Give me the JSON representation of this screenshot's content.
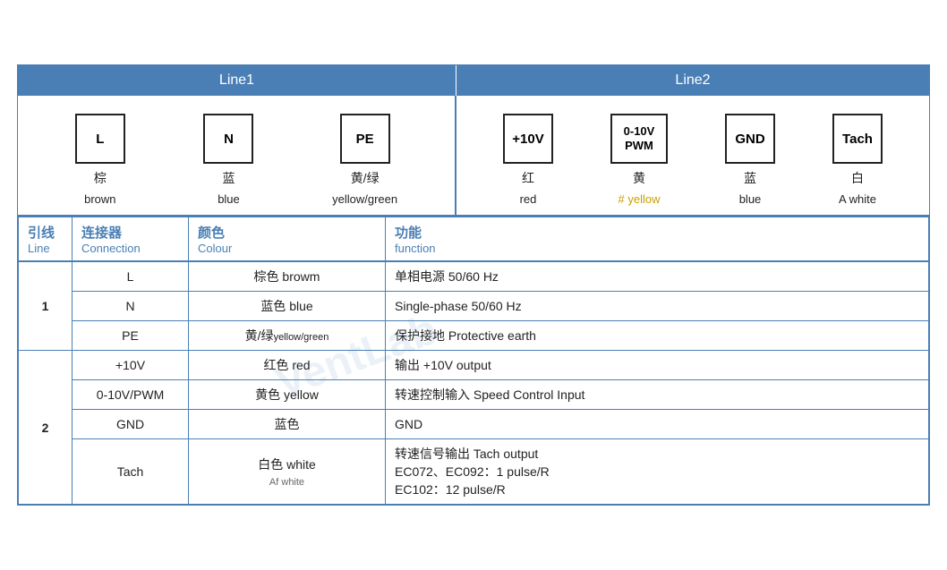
{
  "header": {
    "line1_label": "Line1",
    "line2_label": "Line2"
  },
  "diagram": {
    "line1": [
      {
        "symbol": "L",
        "zh": "棕",
        "en": "brown"
      },
      {
        "symbol": "N",
        "zh": "蓝",
        "en": "blue"
      },
      {
        "symbol": "PE",
        "zh": "黄/绿",
        "en": "yellow/green"
      }
    ],
    "line2": [
      {
        "symbol": "+10V",
        "zh": "红",
        "en": "red"
      },
      {
        "symbol": "0-10V\nPWM",
        "zh": "黄",
        "en": "yellow"
      },
      {
        "symbol": "GND",
        "zh": "蓝",
        "en": "blue"
      },
      {
        "symbol": "Tach",
        "zh": "白",
        "en": "white"
      }
    ]
  },
  "table": {
    "col_headers": [
      {
        "zh": "引线",
        "en": "Line"
      },
      {
        "zh": "连接器",
        "en": "Connection"
      },
      {
        "zh": "颜色",
        "en": "Colour"
      },
      {
        "zh": "功能",
        "en": "function"
      }
    ],
    "rows": [
      {
        "line": "1",
        "rowspan": 3,
        "entries": [
          {
            "conn": "L",
            "colour": "棕色 browm",
            "func": "单相电源 50/60 Hz"
          },
          {
            "conn": "N",
            "colour": "蓝色 blue",
            "func": "Single-phase 50/60 Hz"
          },
          {
            "conn": "PE",
            "colour_zh": "黄/绿",
            "colour_en": "yellow/green",
            "func": "保护接地 Protective earth"
          }
        ]
      },
      {
        "line": "2",
        "rowspan": 4,
        "entries": [
          {
            "conn": "+10V",
            "colour": "红色 red",
            "func": "输出 +10V output"
          },
          {
            "conn": "0-10V/PWM",
            "colour": "黄色 yellow",
            "func": "转速控制输入 Speed Control Input"
          },
          {
            "conn": "GND",
            "colour": "蓝色",
            "func": "GND"
          },
          {
            "conn": "Tach",
            "colour": "白色 white",
            "func_lines": [
              "转速信号输出 Tach output",
              "EC072、EC092：1 pulse/R",
              "EC102：12 pulse/R"
            ]
          }
        ]
      }
    ]
  },
  "watermark": "VentLab"
}
